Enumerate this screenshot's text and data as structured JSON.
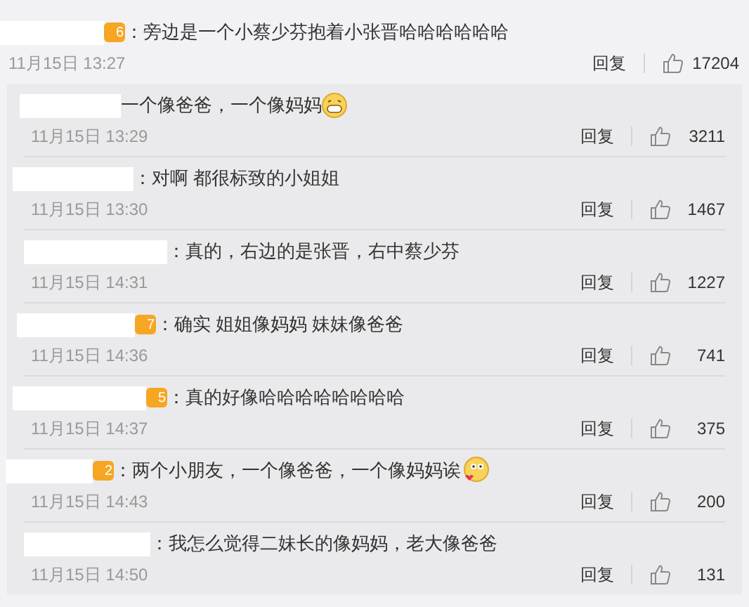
{
  "comment": {
    "badge": "6",
    "text": "：旁边是一个小蔡少芬抱着小张晋哈哈哈哈哈哈",
    "time": "11月15日 13:27",
    "reply_label": "回复",
    "likes": "17204"
  },
  "replies": [
    {
      "text": "一个像爸爸，一个像妈妈",
      "emoji": {
        "kind": "grin"
      },
      "time": "11月15日 13:29",
      "reply_label": "回复",
      "likes": "3211"
    },
    {
      "text": "：对啊 都很标致的小姐姐",
      "time": "11月15日 13:30",
      "reply_label": "回复",
      "likes": "1467"
    },
    {
      "text": "：真的，右边的是张晋，右中蔡少芬",
      "time": "11月15日 14:31",
      "reply_label": "回复",
      "likes": "1227"
    },
    {
      "badge": "7",
      "text": "：确实 姐姐像妈妈 妹妹像爸爸",
      "time": "11月15日 14:36",
      "reply_label": "回复",
      "likes": "741"
    },
    {
      "badge": "5",
      "text": "：真的好像哈哈哈哈哈哈哈哈",
      "time": "11月15日 14:37",
      "reply_label": "回复",
      "likes": "375"
    },
    {
      "badge": "2",
      "text": "：两个小朋友，一个像爸爸，一个像妈妈诶",
      "emoji": {
        "kind": "blush"
      },
      "time": "11月15日 14:43",
      "reply_label": "回复",
      "likes": "200"
    },
    {
      "text": "：我怎么觉得二妹长的像妈妈，老大像爸爸",
      "time": "11月15日 14:50",
      "reply_label": "回复",
      "likes": "131"
    }
  ]
}
